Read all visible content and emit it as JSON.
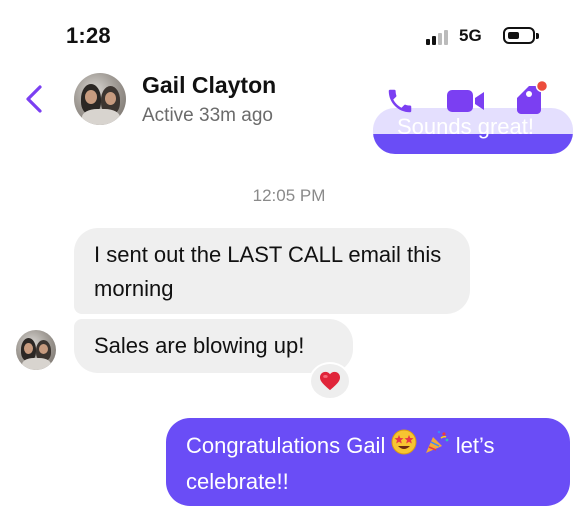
{
  "status_bar": {
    "time": "1:28",
    "network": "5G"
  },
  "header": {
    "contact_name": "Gail Clayton",
    "contact_status": "Active 33m ago",
    "back_icon": "chevron-left-icon",
    "call_icon": "phone-icon",
    "video_icon": "video-camera-icon",
    "tag_icon": "tag-icon",
    "tag_has_notification": true,
    "accent_color": "#7b3ff2"
  },
  "conversation": {
    "previous_partial_message": "Sounds great!",
    "timestamp": "12:05 PM",
    "incoming": [
      {
        "text": "I sent out the LAST CALL email this morning"
      },
      {
        "text": "Sales are blowing up!",
        "reaction_icon": "heart-icon"
      }
    ],
    "outgoing": [
      {
        "text_before": "Congratulations Gail",
        "emoji_1": "star-struck-emoji",
        "emoji_2": "party-popper-emoji",
        "text_after": "let’s celebrate!!"
      }
    ],
    "outgoing_color": "#6a4df6",
    "incoming_color": "#efefef"
  }
}
